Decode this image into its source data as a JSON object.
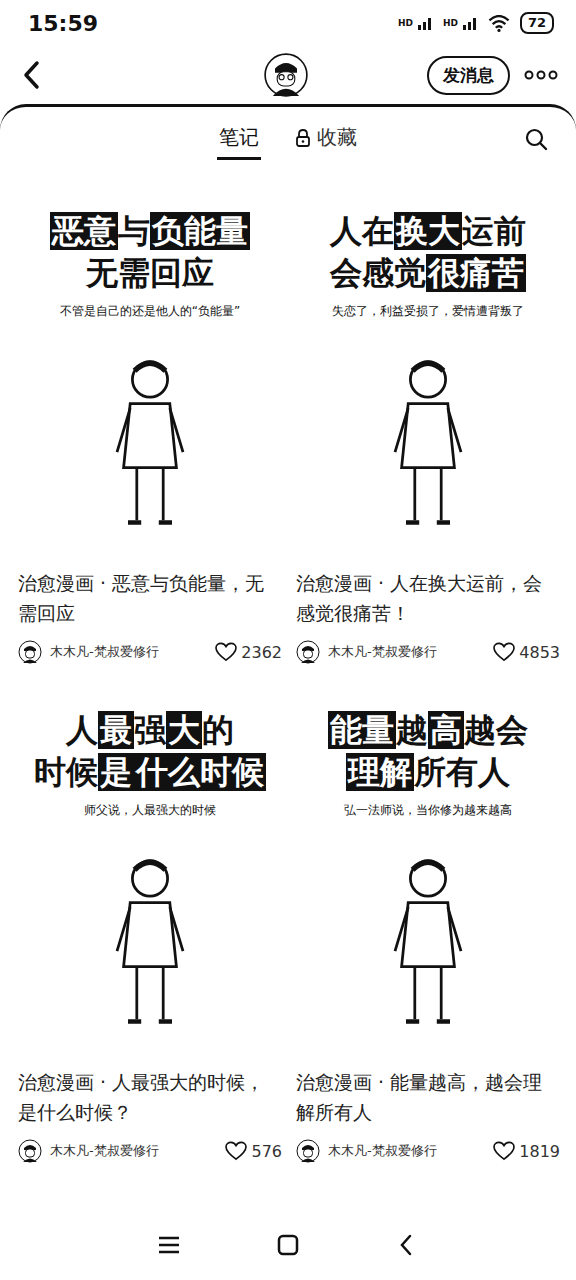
{
  "status_bar": {
    "time": "15:59",
    "network": [
      "HD",
      "HD"
    ],
    "battery": "72"
  },
  "nav": {
    "message_button": "发消息"
  },
  "tabs": [
    {
      "label": "笔记",
      "selected": true,
      "locked": false
    },
    {
      "label": "收藏",
      "selected": false,
      "locked": true
    }
  ],
  "notes": [
    {
      "cover": {
        "lines": [
          [
            {
              "text": "恶意",
              "highlight": true
            },
            {
              "text": "与",
              "highlight": false
            },
            {
              "text": "负能量",
              "highlight": true
            }
          ],
          [
            {
              "text": "无需回应",
              "highlight": false
            }
          ]
        ],
        "caption": "不管是自己的还是他人的“负能量”"
      },
      "title": "治愈漫画 · 恶意与负能量，无需回应",
      "author": "木木凡-梵叔爱修行",
      "likes": "2362"
    },
    {
      "cover": {
        "lines": [
          [
            {
              "text": "人在",
              "highlight": false
            },
            {
              "text": "换大",
              "highlight": true
            },
            {
              "text": "运前",
              "highlight": false
            }
          ],
          [
            {
              "text": "会感觉",
              "highlight": false
            },
            {
              "text": "很痛苦",
              "highlight": true
            }
          ]
        ],
        "caption": "失恋了，利益受损了，爱情遭背叛了"
      },
      "title": "治愈漫画 · 人在换大运前，会感觉很痛苦！",
      "author": "木木凡-梵叔爱修行",
      "likes": "4853"
    },
    {
      "cover": {
        "lines": [
          [
            {
              "text": "人",
              "highlight": false
            },
            {
              "text": "最",
              "highlight": true
            },
            {
              "text": "强",
              "highlight": false
            },
            {
              "text": "大",
              "highlight": true
            },
            {
              "text": "的",
              "highlight": false
            }
          ],
          [
            {
              "text": "时候",
              "highlight": false
            },
            {
              "text": "是",
              "highlight": true
            },
            {
              "text": "什么时候",
              "highlight": true
            }
          ]
        ],
        "caption": "师父说，人最强大的时候"
      },
      "title": "治愈漫画 · 人最强大的时候，是什么时候？",
      "author": "木木凡-梵叔爱修行",
      "likes": "576"
    },
    {
      "cover": {
        "lines": [
          [
            {
              "text": "能量",
              "highlight": true
            },
            {
              "text": "越",
              "highlight": false
            },
            {
              "text": "高",
              "highlight": true
            },
            {
              "text": "越会",
              "highlight": false
            }
          ],
          [
            {
              "text": "理解",
              "highlight": true
            },
            {
              "text": "所有人",
              "highlight": false
            }
          ]
        ],
        "caption": "弘一法师说，当你修为越来越高"
      },
      "title": "治愈漫画 · 能量越高，越会理解所有人",
      "author": "木木凡-梵叔爱修行",
      "likes": "1819"
    }
  ]
}
